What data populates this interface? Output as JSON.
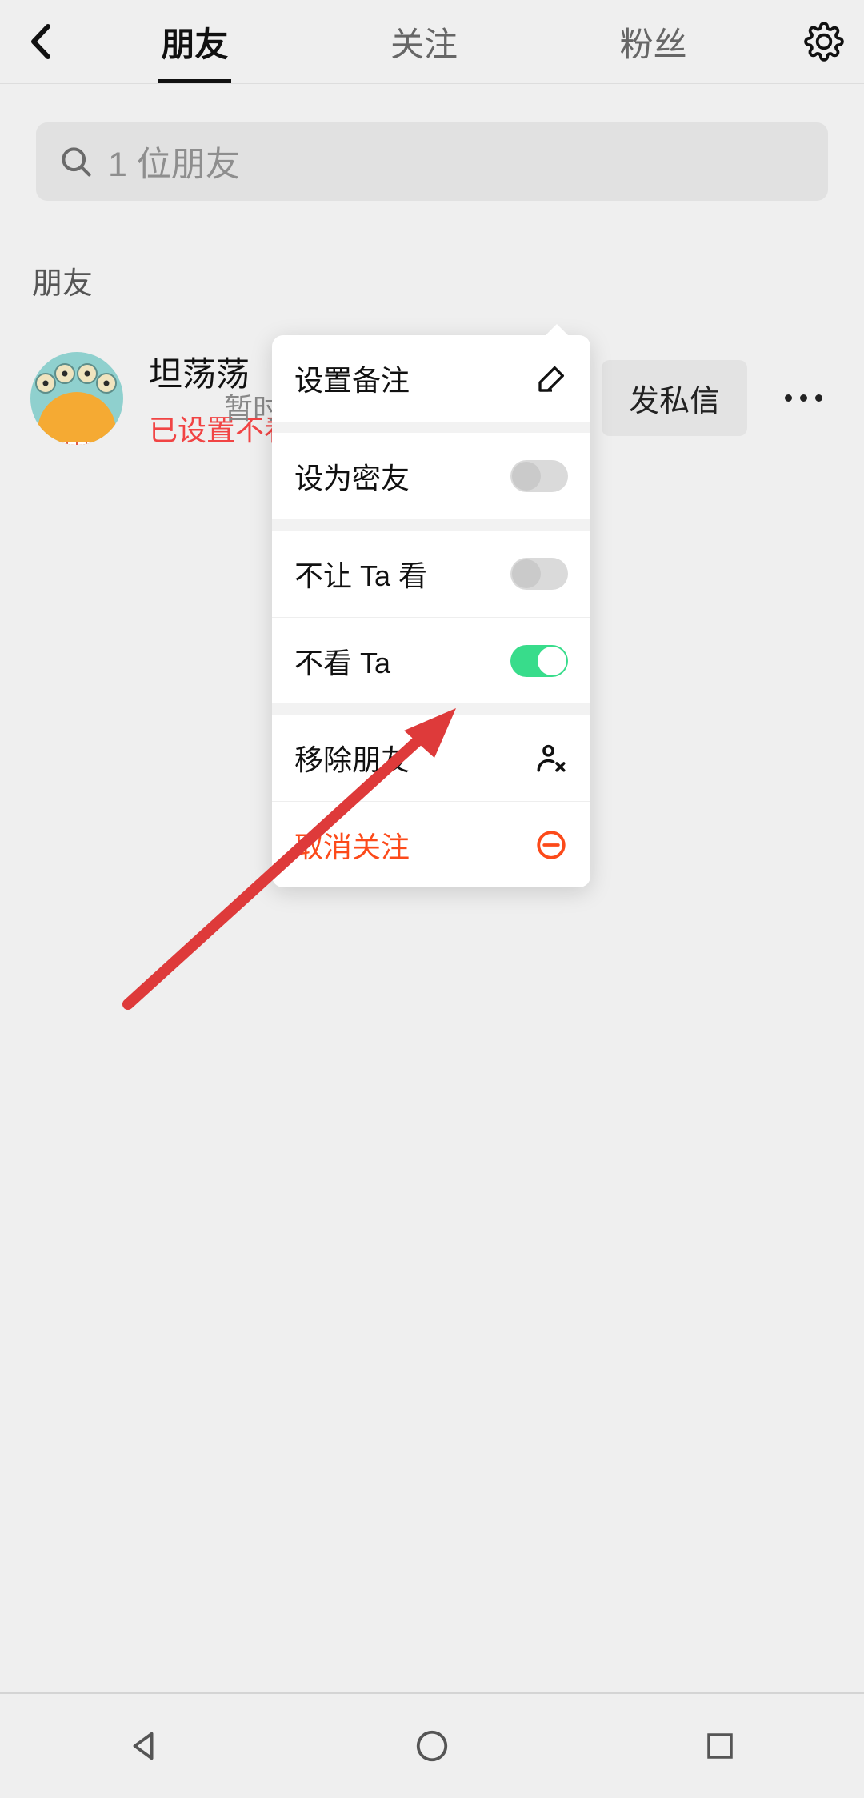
{
  "header": {
    "tabs": [
      "朋友",
      "关注",
      "粉丝"
    ],
    "active_tab_index": 0
  },
  "search": {
    "placeholder": "1 位朋友"
  },
  "section_label": "朋友",
  "friend": {
    "name": "坦荡荡",
    "status": "已设置不看 Ta",
    "msg_button": "发私信"
  },
  "placeholder_text": "暂时",
  "popover": {
    "set_remark": "设置备注",
    "set_close_friend": "设为密友",
    "block_their_view": "不让 Ta 看",
    "hide_their_posts": "不看 Ta",
    "remove_friend": "移除朋友",
    "unfollow": "取消关注",
    "toggles": {
      "set_close_friend": false,
      "block_their_view": false,
      "hide_their_posts": true
    }
  },
  "colors": {
    "accent_red": "#F14444",
    "accent_orange": "#FC4A1A",
    "toggle_on": "#38DC8B"
  }
}
